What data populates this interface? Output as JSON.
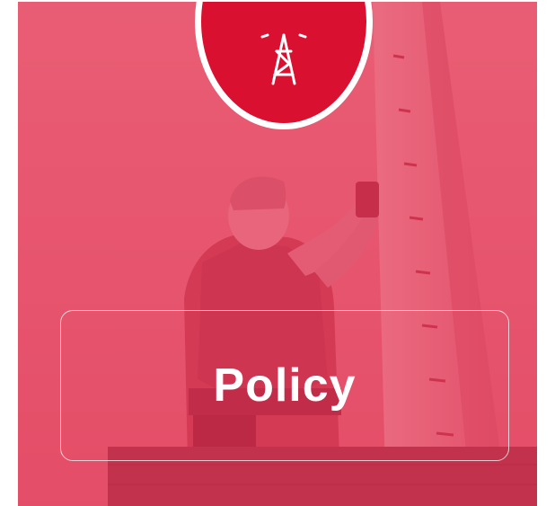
{
  "card": {
    "title": "Policy",
    "icon": "transmission-tower-icon",
    "accent_color": "#d9102f",
    "tint_color": "#e02444"
  }
}
